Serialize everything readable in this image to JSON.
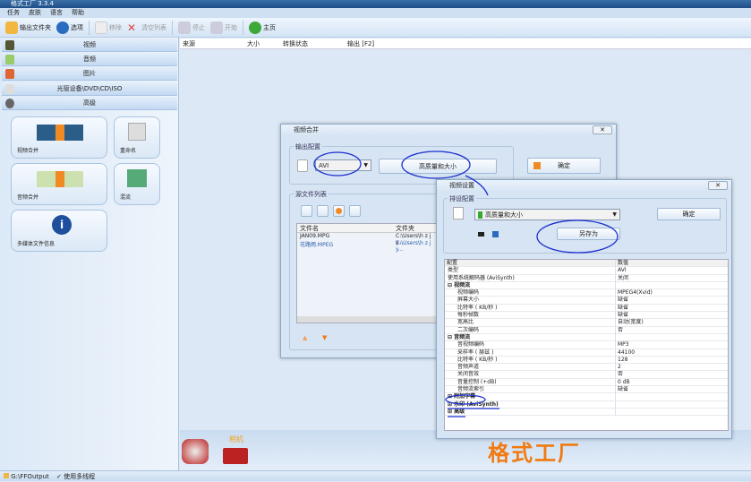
{
  "app": {
    "title": "格式工厂 3.3.4"
  },
  "menu": [
    "任务",
    "皮肤",
    "语言",
    "帮助"
  ],
  "toolbar": {
    "output_folder": "输出文件夹",
    "options": "选项",
    "remove": "移除",
    "clear_list": "清空列表",
    "stop": "停止",
    "start": "开始",
    "home": "主页"
  },
  "categories": [
    "视频",
    "音频",
    "图片",
    "光驱设备\\DVD\\CD\\ISO",
    "高级"
  ],
  "tiles": [
    "视频合并",
    "重命名",
    "音频合并",
    "混流",
    "多媒体文件信息"
  ],
  "task_columns": [
    "来源",
    "大小",
    "转换状态",
    "输出 [F2]"
  ],
  "bottom": {
    "camera_label": "相机",
    "watermark": "格式工厂"
  },
  "status": {
    "output_path": "G:\\FFOutput",
    "multithread": "使用多线程"
  },
  "merge_dialog": {
    "title": "视频合并",
    "output_group": "输出配置",
    "format": "AVI",
    "preset_button": "高质量和大小",
    "ok": "确定",
    "source_group": "源文件列表",
    "columns": [
      "文件名",
      "文件夹"
    ],
    "files": [
      {
        "name": "JAN09.MPG",
        "folder": "C:\\Users\\h z j y..."
      },
      {
        "name": "花路雨.MPEG",
        "folder": "C:\\Users\\h z j y..."
      }
    ]
  },
  "settings_dialog": {
    "title": "视频设置",
    "preset_group": "排设配置",
    "preset": "高质量和大小",
    "ok": "确定",
    "save_as": "另存为",
    "columns": [
      "配置",
      "数值"
    ],
    "rows": [
      {
        "k": "类型",
        "v": "AVI"
      },
      {
        "k": "使用系统解码器 (AviSynth)",
        "v": "关闭"
      },
      {
        "k": "⊟ 视频流",
        "v": "",
        "sec": true
      },
      {
        "k": "视频编码",
        "v": "MPEG4(Xvid)",
        "i": true
      },
      {
        "k": "屏幕大小",
        "v": "缺省",
        "i": true
      },
      {
        "k": "比特率 ( KB/秒 )",
        "v": "缺省",
        "i": true
      },
      {
        "k": "每秒帧数",
        "v": "缺省",
        "i": true
      },
      {
        "k": "宽高比",
        "v": "自动(宽度)",
        "i": true
      },
      {
        "k": "二次编码",
        "v": "否",
        "i": true
      },
      {
        "k": "⊟ 音频流",
        "v": "",
        "sec": true
      },
      {
        "k": "音视频编码",
        "v": "MP3",
        "i": true
      },
      {
        "k": "采样率 ( 赫兹 )",
        "v": "44100",
        "i": true
      },
      {
        "k": "比特率 ( KB/秒 )",
        "v": "128",
        "i": true
      },
      {
        "k": "音频声道",
        "v": "2",
        "i": true
      },
      {
        "k": "关闭音效",
        "v": "否",
        "i": true
      },
      {
        "k": "音量控制 (+dB)",
        "v": "0 dB",
        "i": true
      },
      {
        "k": "音频流索引",
        "v": "缺省",
        "i": true
      },
      {
        "k": "⊞ 附加字幕",
        "v": "",
        "sec": true
      },
      {
        "k": "⊞ 水印 (AviSynth)",
        "v": "",
        "sec": true
      },
      {
        "k": "⊞ 高级",
        "v": "",
        "sec": true
      }
    ]
  },
  "colors": {
    "accent": "#f08a24",
    "annotation": "#1a2fd0"
  }
}
